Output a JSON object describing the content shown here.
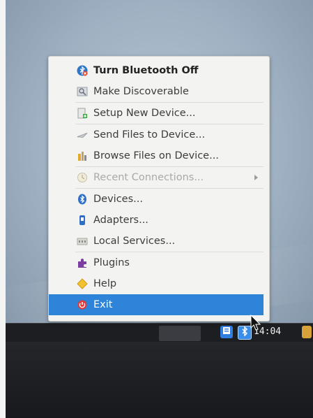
{
  "menu": {
    "items": [
      {
        "label": "Turn Bluetooth Off",
        "icon": "bluetooth-off-icon"
      },
      {
        "label": "Make Discoverable",
        "icon": "discoverable-icon"
      },
      {
        "label": "Setup New Device...",
        "icon": "setup-device-icon"
      },
      {
        "label": "Send Files to Device...",
        "icon": "send-files-icon"
      },
      {
        "label": "Browse Files on Device...",
        "icon": "browse-files-icon"
      },
      {
        "label": "Recent Connections...",
        "icon": "recent-connections-icon"
      },
      {
        "label": "Devices...",
        "icon": "bluetooth-icon"
      },
      {
        "label": "Adapters...",
        "icon": "adapter-icon"
      },
      {
        "label": "Local Services...",
        "icon": "local-services-icon"
      },
      {
        "label": "Plugins",
        "icon": "puzzle-icon"
      },
      {
        "label": "Help",
        "icon": "help-icon"
      },
      {
        "label": "Exit",
        "icon": "exit-icon"
      }
    ]
  },
  "taskbar": {
    "clock": "14:04",
    "tray_icons": [
      "notes-icon",
      "bluetooth-tray-icon",
      "network-icon"
    ]
  },
  "colors": {
    "selection": "#2d84d9",
    "menu_bg": "#f3f3f1",
    "disabled_text": "#a9a9a9"
  }
}
